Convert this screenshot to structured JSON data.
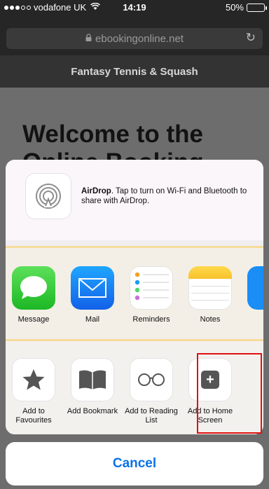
{
  "status_bar": {
    "carrier": "vodafone UK",
    "time": "14:19",
    "battery_percent_label": "50%",
    "battery_level": 0.5
  },
  "browser": {
    "url": "ebookingonline.net"
  },
  "page": {
    "site_title": "Fantasy Tennis & Squash",
    "heading": "Welcome to the Online Booking"
  },
  "share_sheet": {
    "airdrop": {
      "title": "AirDrop",
      "message": ". Tap to turn on Wi-Fi and Bluetooth to share with AirDrop."
    },
    "apps": [
      {
        "label": "Message",
        "icon": "message-icon"
      },
      {
        "label": "Mail",
        "icon": "mail-icon"
      },
      {
        "label": "Reminders",
        "icon": "reminders-icon"
      },
      {
        "label": "Notes",
        "icon": "notes-icon"
      }
    ],
    "actions": [
      {
        "label": "Add to Favourites",
        "icon": "star-icon"
      },
      {
        "label": "Add Bookmark",
        "icon": "book-icon"
      },
      {
        "label": "Add to Reading List",
        "icon": "glasses-icon"
      },
      {
        "label": "Add to Home Screen",
        "icon": "plus-square-icon"
      }
    ],
    "cancel_label": "Cancel"
  },
  "colors": {
    "accent": "#0a73e8",
    "highlight_box": "#e01010"
  }
}
